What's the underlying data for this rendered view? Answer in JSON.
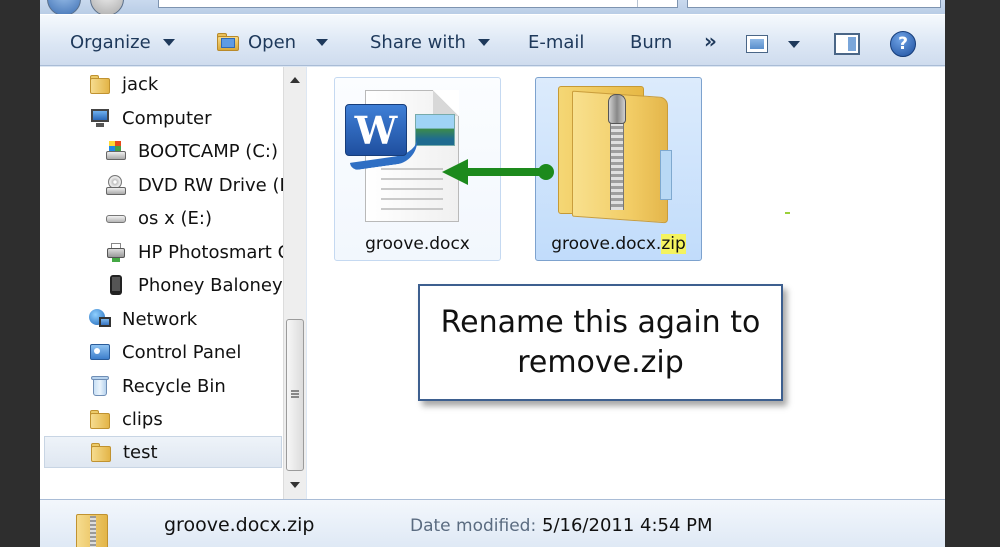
{
  "toolbar": {
    "organize": "Organize",
    "open": "Open",
    "share_with": "Share with",
    "email": "E-mail",
    "burn": "Burn",
    "more": "»",
    "help": "?"
  },
  "nav_pane": {
    "items": [
      {
        "label": "jack",
        "icon": "user-folder-icon"
      },
      {
        "label": "Computer",
        "icon": "computer-icon"
      },
      {
        "label": "BOOTCAMP (C:)",
        "icon": "windows-drive-icon"
      },
      {
        "label": "DVD RW Drive (D",
        "icon": "dvd-drive-icon"
      },
      {
        "label": "os x (E:)",
        "icon": "removable-drive-icon"
      },
      {
        "label": "HP Photosmart C",
        "icon": "printer-icon"
      },
      {
        "label": "Phoney Baloney",
        "icon": "phone-icon"
      },
      {
        "label": "Network",
        "icon": "network-icon"
      },
      {
        "label": "Control Panel",
        "icon": "control-panel-icon"
      },
      {
        "label": "Recycle Bin",
        "icon": "recycle-bin-icon"
      },
      {
        "label": "clips",
        "icon": "folder-icon"
      },
      {
        "label": "test",
        "icon": "folder-icon",
        "selected": true
      }
    ]
  },
  "content": {
    "files": [
      {
        "name": "groove.docx",
        "icon": "word-document-icon"
      },
      {
        "name_base": "groove.docx.",
        "name_highlight": "zip",
        "icon": "zip-folder-icon",
        "selected": true
      }
    ],
    "callout": "Rename this again to remove.zip"
  },
  "details": {
    "file_name": "groove.docx.zip",
    "date_label": "Date modified:",
    "date_value": "5/16/2011 4:54 PM"
  },
  "colors": {
    "arrow": "#1d8a1d",
    "highlight": "#f4f35f",
    "selection": "#c1dcfb"
  }
}
